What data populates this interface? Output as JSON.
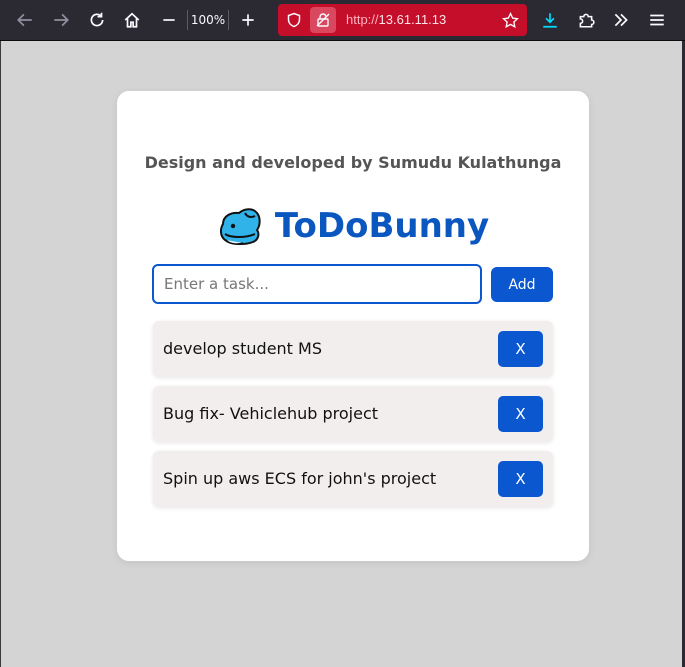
{
  "browser": {
    "zoom": "100%",
    "url_protocol": "http://",
    "url_host": "13.61.11.13",
    "icons": {
      "back": "back-arrow-icon",
      "forward": "forward-arrow-icon",
      "reload": "reload-icon",
      "home": "home-icon",
      "zoom_out": "minus-icon",
      "zoom_in": "plus-icon",
      "shield": "shield-icon",
      "insecure_lock": "insecure-lock-icon",
      "bookmark": "star-icon",
      "downloads": "download-icon",
      "extensions": "puzzle-icon",
      "overflow": "chevrons-right-icon",
      "menu": "hamburger-menu-icon"
    },
    "colors": {
      "toolbar": "#2b2a33",
      "urlbar_insecure": "#c50e29"
    }
  },
  "app": {
    "credit": "Design and developed by Sumudu Kulathunga",
    "title": "ToDoBunny",
    "logo_icon": "whale-logo-icon",
    "input_placeholder": "Enter a task...",
    "input_value": "",
    "add_label": "Add",
    "tasks": [
      {
        "text": "develop student MS",
        "delete_label": "X"
      },
      {
        "text": "Bug fix- Vehiclehub project",
        "delete_label": "X"
      },
      {
        "text": "Spin up aws ECS for john's project",
        "delete_label": "X"
      }
    ],
    "colors": {
      "accent": "#0b57d0",
      "title": "#0b57c0",
      "task_bg": "#f3eeee",
      "page_bg": "#d4d4d4"
    }
  }
}
